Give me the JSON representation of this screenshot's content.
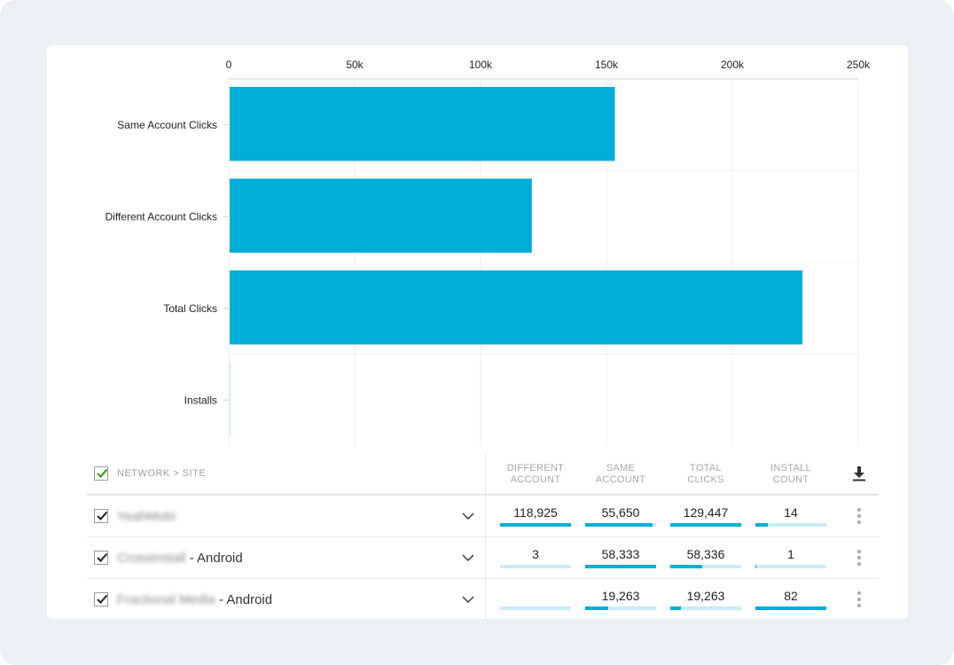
{
  "chart_data": {
    "type": "bar",
    "orientation": "horizontal",
    "categories": [
      "Same Account Clicks",
      "Different Account Clicks",
      "Total Clicks",
      "Installs"
    ],
    "values": [
      153000,
      120000,
      227500,
      97
    ],
    "xlim": [
      0,
      250000
    ],
    "xticks": [
      0,
      50000,
      100000,
      150000,
      200000,
      250000
    ],
    "xtick_labels": [
      "0",
      "50k",
      "100k",
      "150k",
      "200k",
      "250k"
    ],
    "xaxis_position": "top",
    "grid": true,
    "title": "",
    "xlabel": "",
    "ylabel": "",
    "bar_color": "#00aed8"
  },
  "table": {
    "header": {
      "name_label": "NETWORK > SITE",
      "columns": [
        {
          "line1": "DIFFERENT",
          "line2": "ACCOUNT"
        },
        {
          "line1": "SAME",
          "line2": "ACCOUNT"
        },
        {
          "line1": "TOTAL",
          "line2": "CLICKS"
        },
        {
          "line1": "INSTALL",
          "line2": "COUNT"
        }
      ],
      "download_icon": "download-icon"
    },
    "rows": [
      {
        "name_blurred": "YeahMobi",
        "name_suffix": "",
        "cells": [
          {
            "value": "118,925",
            "fraction": 1.0
          },
          {
            "value": "55,650",
            "fraction": 0.954
          },
          {
            "value": "129,447",
            "fraction": 1.0
          },
          {
            "value": "14",
            "fraction": 0.17
          }
        ]
      },
      {
        "name_blurred": "Crossinstall",
        "name_suffix": " - Android",
        "cells": [
          {
            "value": "3",
            "fraction": 0.0
          },
          {
            "value": "58,333",
            "fraction": 1.0
          },
          {
            "value": "58,336",
            "fraction": 0.45
          },
          {
            "value": "1",
            "fraction": 0.012
          }
        ]
      },
      {
        "name_blurred": "Fractional Media",
        "name_suffix": " - Android",
        "cells": [
          {
            "value": "",
            "fraction": 0.0
          },
          {
            "value": "19,263",
            "fraction": 0.33
          },
          {
            "value": "19,263",
            "fraction": 0.149
          },
          {
            "value": "82",
            "fraction": 1.0
          }
        ]
      }
    ]
  },
  "colors": {
    "accent": "#00aed8",
    "accent_light": "#c8ecf7",
    "check_green": "#4a9a2a",
    "background": "#eceff3"
  }
}
